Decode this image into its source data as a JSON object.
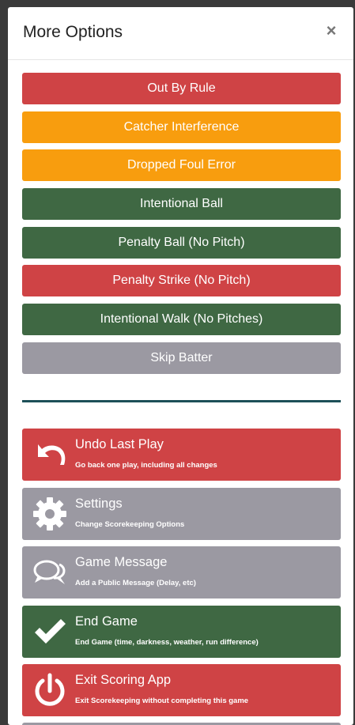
{
  "modal": {
    "title": "More Options",
    "close_label": "×"
  },
  "options": [
    {
      "label": "Out By Rule",
      "color": "red"
    },
    {
      "label": "Catcher Interference",
      "color": "orange"
    },
    {
      "label": "Dropped Foul Error",
      "color": "orange"
    },
    {
      "label": "Intentional Ball",
      "color": "green"
    },
    {
      "label": "Penalty Ball (No Pitch)",
      "color": "green"
    },
    {
      "label": "Penalty Strike (No Pitch)",
      "color": "red"
    },
    {
      "label": "Intentional Walk (No Pitches)",
      "color": "green"
    },
    {
      "label": "Skip Batter",
      "color": "gray"
    }
  ],
  "actions": [
    {
      "title": "Undo Last Play",
      "subtitle": "Go back one play, including all changes",
      "icon": "undo-icon",
      "color": "red"
    },
    {
      "title": "Settings",
      "subtitle": "Change Scorekeeping Options",
      "icon": "gear-icon",
      "color": "gray"
    },
    {
      "title": "Game Message",
      "subtitle": "Add a Public Message (Delay, etc)",
      "icon": "chat-icon",
      "color": "gray"
    },
    {
      "title": "End Game",
      "subtitle": "End Game (time, darkness, weather, run difference)",
      "icon": "check-icon",
      "color": "green"
    },
    {
      "title": "Exit Scoring App",
      "subtitle": "Exit Scorekeeping without completing this game",
      "icon": "power-icon",
      "color": "red"
    }
  ],
  "colors": {
    "red": "#cf4345",
    "orange": "#f89d0e",
    "green": "#3f6843",
    "gray": "#9b99a2",
    "divider": "#1d5058"
  }
}
